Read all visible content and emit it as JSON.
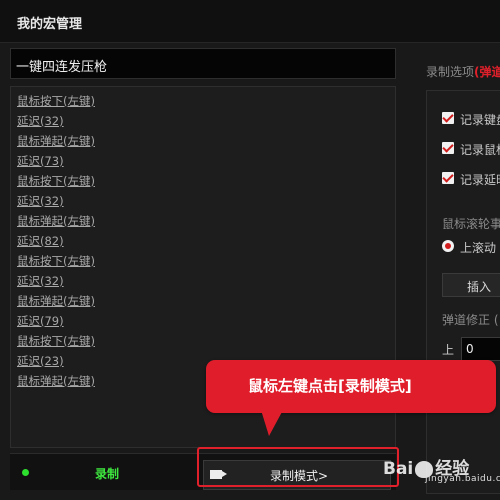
{
  "window": {
    "title": "我的宏管理"
  },
  "macro": {
    "name": "一键四连发压枪",
    "steps": [
      "鼠标按下(左键)",
      "延迟(32)",
      "鼠标弹起(左键)",
      "延迟(73)",
      "鼠标按下(左键)",
      "延迟(32)",
      "鼠标弹起(左键)",
      "延迟(82)",
      "鼠标按下(左键)",
      "延迟(32)",
      "鼠标弹起(左键)",
      "延迟(79)",
      "鼠标按下(左键)",
      "延迟(23)",
      "鼠标弹起(左键)"
    ]
  },
  "bottom": {
    "record_label": "录制",
    "record_mode_label": "录制模式>",
    "record_indicator_color": "#2ee02e"
  },
  "options": {
    "title_prefix": "录制选项",
    "title_suffix": "(弹道",
    "checkboxes": [
      {
        "label": "记录键盘",
        "checked": true
      },
      {
        "label": "记录鼠标",
        "checked": true
      },
      {
        "label": "记录延时",
        "checked": true
      }
    ],
    "wheel_label": "鼠标滚轮事",
    "wheel_option": {
      "label": "上滚动",
      "selected": true
    },
    "insert_label": "插入",
    "ballistic_label": "弹道修正 (",
    "up_label": "上",
    "up_value": "0"
  },
  "annotation": {
    "callout_text": "鼠标左键点击[录制模式]",
    "accent_color": "#e01e2b"
  },
  "watermark": {
    "brand_main": "Bai",
    "brand_tail": "经验",
    "brand_sub": "jingyan.baidu.com"
  }
}
